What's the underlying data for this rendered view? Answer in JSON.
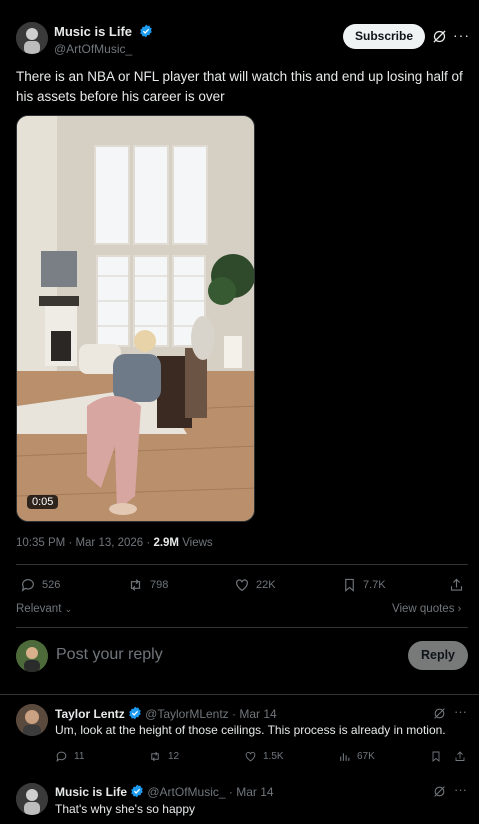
{
  "post": {
    "author_name": "Music is Life",
    "author_handle": "@ArtOfMusic_",
    "subscribe_label": "Subscribe",
    "text": "There is an NBA or NFL player that will watch this and end up losing half of his assets before his career is over",
    "video_duration": "0:05",
    "timestamp": "10:35 PM · Mar 13, 2026 · ",
    "views_count": "2.9M",
    "views_label": " Views"
  },
  "actions": {
    "replies": "526",
    "reposts": "798",
    "likes": "22K",
    "bookmarks": "7.7K"
  },
  "sort": {
    "relevant_label": "Relevant",
    "view_quotes_label": "View quotes"
  },
  "composer": {
    "placeholder": "Post your reply",
    "reply_button": "Reply"
  },
  "replies": [
    {
      "name": "Taylor Lentz",
      "handle": "@TaylorMLentz",
      "date": "· Mar 14",
      "text": "Um, look at the height of those ceilings. This process is already in motion.",
      "stats": {
        "replies": "11",
        "reposts": "12",
        "likes": "1.5K",
        "views": "67K"
      }
    },
    {
      "name": "Music is Life",
      "handle": "@ArtOfMusic_",
      "date": "· Mar 14",
      "text": "That's why she's so happy"
    }
  ],
  "colors": {
    "background": "#000000",
    "verified": "#1d9bf0",
    "muted": "#71767b",
    "divider": "#2f3336"
  }
}
